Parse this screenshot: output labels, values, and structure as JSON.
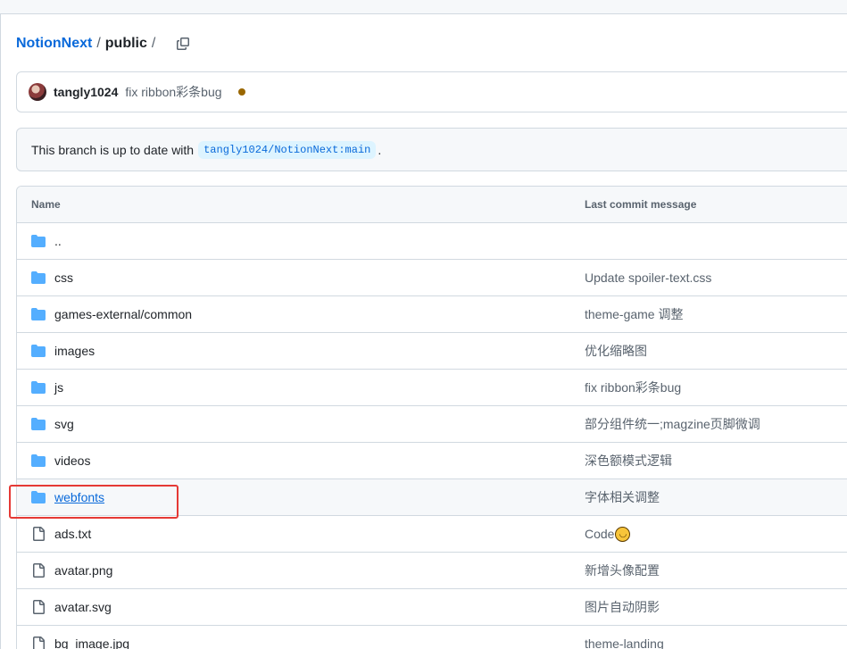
{
  "breadcrumb": {
    "root": "NotionNext",
    "sep1": "/",
    "current": "public",
    "sep2": "/",
    "copy_icon": "copy-icon"
  },
  "commit": {
    "author": "tangly1024",
    "message": "fix ribbon彩条bug",
    "status_color": "#9a6700"
  },
  "branch": {
    "prefix": "This branch is up to date with",
    "ref": "tangly1024/NotionNext:main",
    "suffix": "."
  },
  "table": {
    "headers": {
      "name": "Name",
      "message": "Last commit message"
    },
    "rows": [
      {
        "type": "folder",
        "name": "..",
        "message": ""
      },
      {
        "type": "folder",
        "name": "css",
        "message": "Update spoiler-text.css"
      },
      {
        "type": "folder",
        "name": "games-external/common",
        "message": "theme-game 调整"
      },
      {
        "type": "folder",
        "name": "images",
        "message": "优化缩略图"
      },
      {
        "type": "folder",
        "name": "js",
        "message": "fix ribbon彩条bug"
      },
      {
        "type": "folder",
        "name": "svg",
        "message": "部分组件统一;magzine页脚微调"
      },
      {
        "type": "folder",
        "name": "videos",
        "message": "深色额模式逻辑"
      },
      {
        "type": "folder",
        "name": "webfonts",
        "message": "字体相关调整"
      },
      {
        "type": "file",
        "name": "ads.txt",
        "message": "Code"
      },
      {
        "type": "file",
        "name": "avatar.png",
        "message": "新增头像配置"
      },
      {
        "type": "file",
        "name": "avatar.svg",
        "message": "图片自动阴影"
      },
      {
        "type": "file",
        "name": "bg_image.jpg",
        "message": "theme-landing"
      }
    ]
  },
  "colors": {
    "link": "#0969da",
    "folder": "#54aeff",
    "annotation": "#e53935"
  }
}
